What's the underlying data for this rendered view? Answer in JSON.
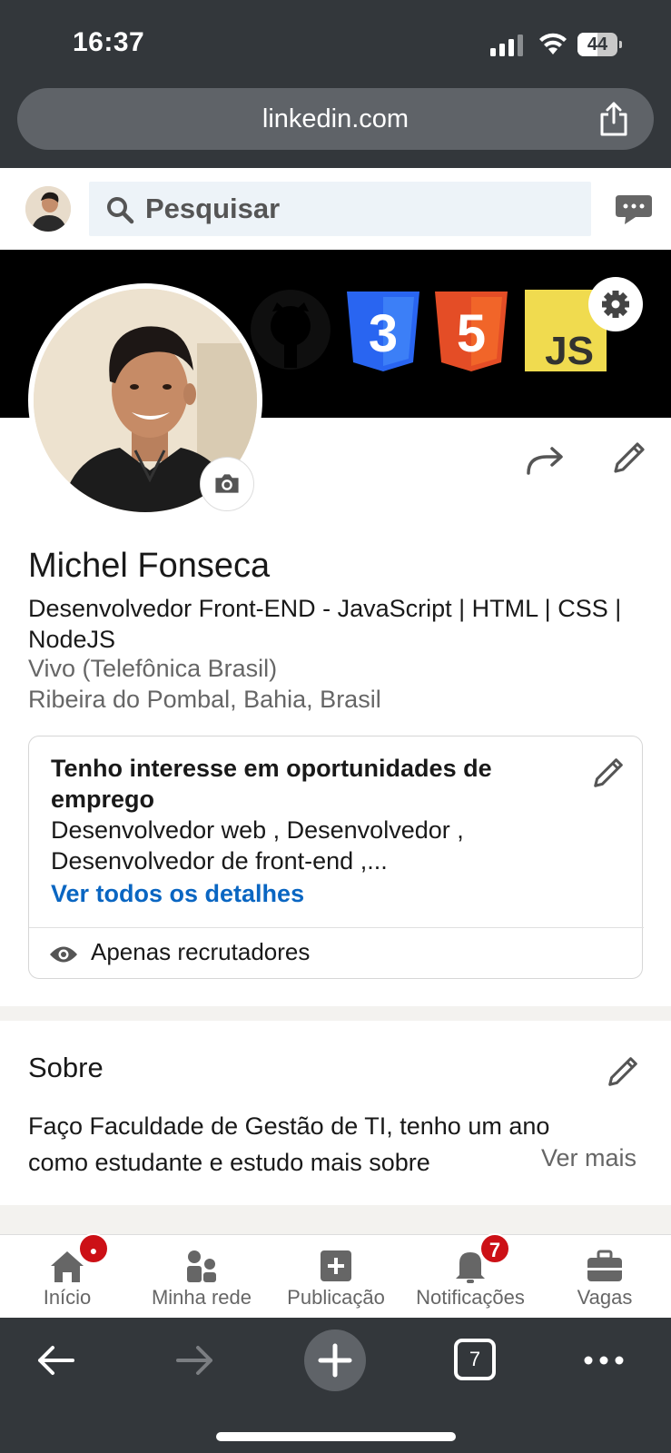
{
  "status_bar": {
    "time": "16:37",
    "battery": "44"
  },
  "browser": {
    "url": "linkedin.com",
    "tabs_count": "7"
  },
  "header": {
    "search_placeholder": "Pesquisar"
  },
  "banner": {
    "logos": [
      "github-icon",
      "css3-icon",
      "html5-icon",
      "js-icon"
    ],
    "js_text": "JS"
  },
  "profile": {
    "name": "Michel Fonseca",
    "headline": "Desenvolvedor Front-END - JavaScript | HTML | CSS | NodeJS",
    "company": "Vivo (Telefônica Brasil)",
    "location": "Ribeira do Pombal, Bahia, Brasil"
  },
  "open_to_work": {
    "title": "Tenho interesse em oportunidades de emprego",
    "roles": "Desenvolvedor web , Desenvolvedor , Desenvolvedor de front-end ,...",
    "link": "Ver todos os detalhes",
    "visibility": "Apenas recrutadores"
  },
  "about": {
    "title": "Sobre",
    "text": "Faço Faculdade de Gestão de TI, tenho um ano como estudante e estudo mais sobre",
    "more": "Ver mais"
  },
  "bottom_nav": {
    "items": [
      {
        "label": "Início",
        "icon": "home-icon",
        "badge": "dot"
      },
      {
        "label": "Minha rede",
        "icon": "network-icon"
      },
      {
        "label": "Publicação",
        "icon": "post-icon"
      },
      {
        "label": "Notificações",
        "icon": "bell-icon",
        "badge": "7"
      },
      {
        "label": "Vagas",
        "icon": "briefcase-icon"
      }
    ]
  },
  "colors": {
    "accent": "#0a66c2",
    "badge": "#cc1016",
    "chrome": "#33373b"
  }
}
